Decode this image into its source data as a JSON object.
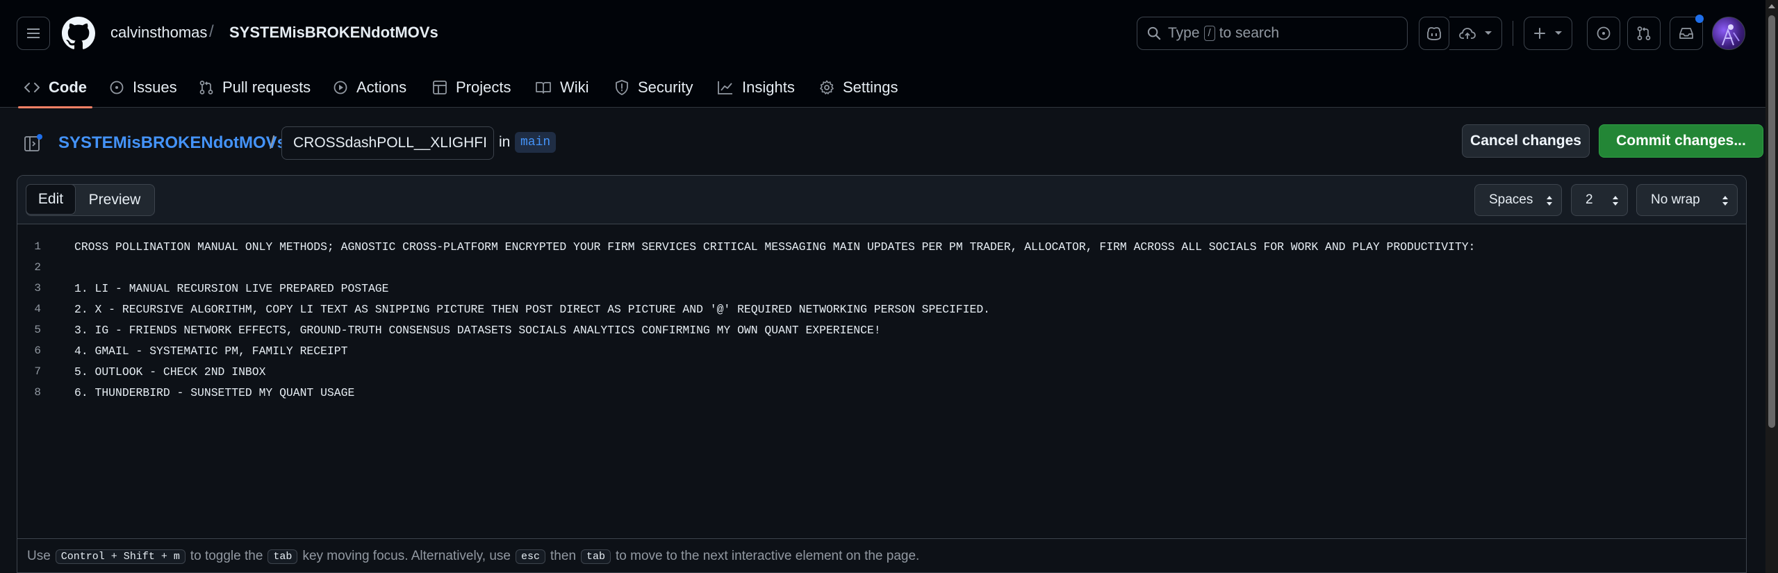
{
  "header": {
    "owner": "calvinsthomas",
    "separator": "/",
    "repo": "SYSTEMisBROKENdotMOVs",
    "search": {
      "prefix": "Type",
      "key": "/",
      "suffix": "to search"
    }
  },
  "nav": {
    "tabs": [
      {
        "label": "Code",
        "icon": "code-icon",
        "active": true
      },
      {
        "label": "Issues",
        "icon": "issue-icon"
      },
      {
        "label": "Pull requests",
        "icon": "pull-request-icon"
      },
      {
        "label": "Actions",
        "icon": "play-icon"
      },
      {
        "label": "Projects",
        "icon": "table-icon"
      },
      {
        "label": "Wiki",
        "icon": "book-icon"
      },
      {
        "label": "Security",
        "icon": "shield-icon"
      },
      {
        "label": "Insights",
        "icon": "graph-icon"
      },
      {
        "label": "Settings",
        "icon": "gear-icon"
      }
    ]
  },
  "file": {
    "repo_link": "SYSTEMisBROKENdotMOVs",
    "path_sep": "/",
    "filename": "CROSSdashPOLL__XLIGHFI",
    "in_label": "in",
    "branch": "main",
    "cancel_label": "Cancel changes",
    "commit_label": "Commit changes..."
  },
  "editor": {
    "edit_label": "Edit",
    "preview_label": "Preview",
    "indent_mode": "Spaces",
    "indent_size": "2",
    "wrap_mode": "No wrap",
    "lines": [
      {
        "n": "1",
        "text": "CROSS POLLINATION MANUAL ONLY METHODS; AGNOSTIC CROSS-PLATFORM ENCRYPTED YOUR FIRM SERVICES CRITICAL MESSAGING MAIN UPDATES PER PM TRADER, ALLOCATOR, FIRM ACROSS ALL SOCIALS FOR WORK AND PLAY PRODUCTIVITY:"
      },
      {
        "n": "2",
        "text": ""
      },
      {
        "n": "3",
        "text": "1. LI - MANUAL RECURSION LIVE PREPARED POSTAGE"
      },
      {
        "n": "4",
        "text": "2. X - RECURSIVE ALGORITHM, COPY LI TEXT AS SNIPPING PICTURE THEN POST DIRECT AS PICTURE AND '@' REQUIRED NETWORKING PERSON SPECIFIED."
      },
      {
        "n": "5",
        "text": "3. IG - FRIENDS NETWORK EFFECTS, GROUND-TRUTH CONSENSUS DATASETS SOCIALS ANALYTICS CONFIRMING MY OWN QUANT EXPERIENCE!"
      },
      {
        "n": "6",
        "text": "4. GMAIL - SYSTEMATIC PM, FAMILY RECEIPT"
      },
      {
        "n": "7",
        "text": "5. OUTLOOK - CHECK 2ND INBOX"
      },
      {
        "n": "8",
        "text": "6. THUNDERBIRD - SUNSETTED MY QUANT USAGE"
      }
    ]
  },
  "footer": {
    "t1": "Use",
    "k1": "Control + Shift + m",
    "t2": "to toggle the",
    "k2": "tab",
    "t3": "key moving focus. Alternatively, use",
    "k3": "esc",
    "t4": "then",
    "k4": "tab",
    "t5": "to move to the next interactive element on the page."
  },
  "colors": {
    "accent_link": "#4493f8",
    "commit_green": "#238636",
    "active_tab_underline": "#f78166",
    "notification_dot": "#1f6feb"
  }
}
